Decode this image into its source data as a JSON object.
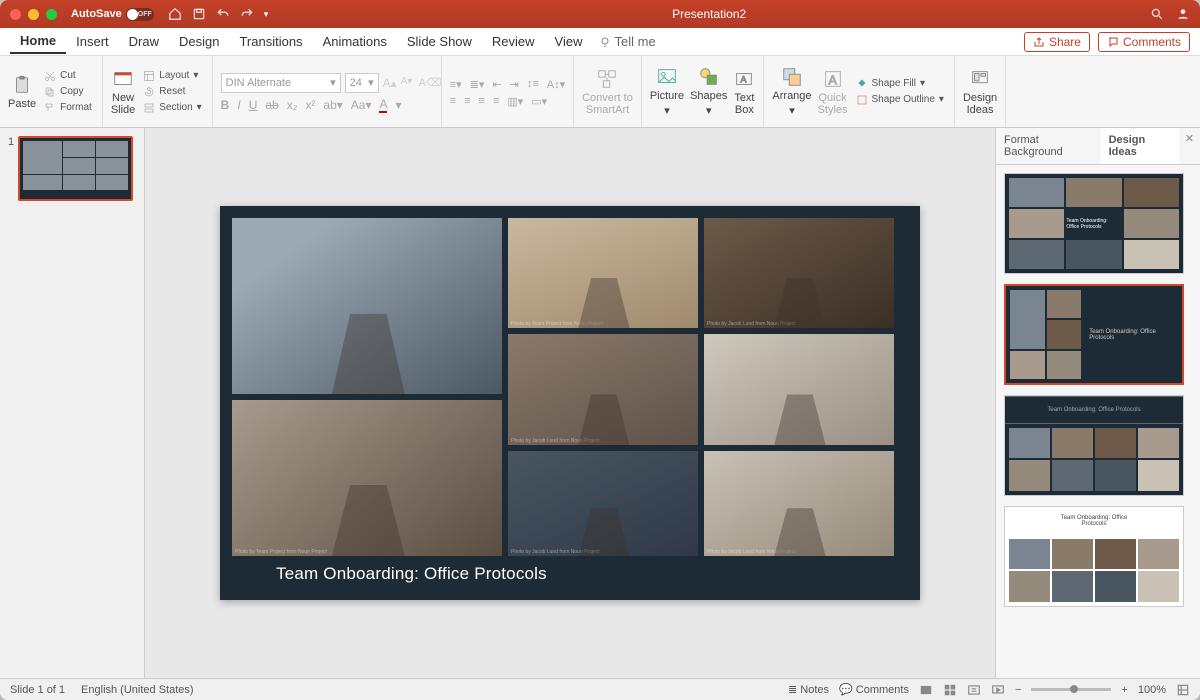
{
  "titlebar": {
    "autosave_label": "AutoSave",
    "doc_title": "Presentation2"
  },
  "menu": {
    "tabs": [
      "Home",
      "Insert",
      "Draw",
      "Design",
      "Transitions",
      "Animations",
      "Slide Show",
      "Review",
      "View"
    ],
    "tellme": "Tell me",
    "share": "Share",
    "comments": "Comments"
  },
  "ribbon": {
    "paste": "Paste",
    "cut": "Cut",
    "copy": "Copy",
    "format": "Format",
    "new_slide": "New\nSlide",
    "layout": "Layout",
    "reset": "Reset",
    "section": "Section",
    "font_name": "DIN Alternate",
    "font_size": "24",
    "convert_smartart": "Convert to\nSmartArt",
    "picture": "Picture",
    "shapes": "Shapes",
    "text_box": "Text\nBox",
    "arrange": "Arrange",
    "quick_styles": "Quick\nStyles",
    "shape_fill": "Shape Fill",
    "shape_outline": "Shape Outline",
    "design_ideas": "Design\nIdeas"
  },
  "thumb": {
    "num": "1"
  },
  "slide": {
    "title": "Team Onboarding: Office Protocols",
    "credits": [
      "Photo by Team Project from Noun Project",
      "Photo by Jacob Lund from Noun Project",
      "Photo by Jacob Lund from Noun Project",
      "Photo by Jacob Lund from Noun Project",
      "Photo by Jacob Lund from Noun Project"
    ]
  },
  "sidepane": {
    "tab_format": "Format Background",
    "tab_ideas": "Design Ideas",
    "idea_titles": [
      "Team Onboarding: Office Protocols",
      "Team Onboarding: Office\nProtocols",
      "Team Onboarding: Office Protocols",
      "Team Onboarding: Office\nProtocols"
    ]
  },
  "status": {
    "slide": "Slide 1 of 1",
    "lang": "English (United States)",
    "notes": "Notes",
    "comments": "Comments",
    "zoom": "100%"
  }
}
